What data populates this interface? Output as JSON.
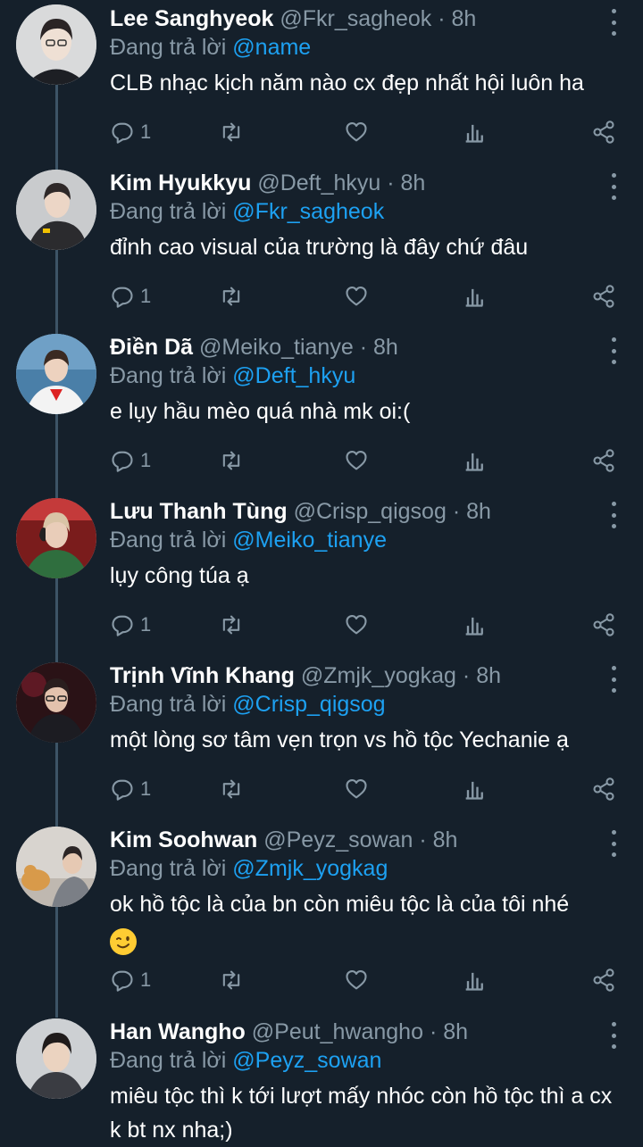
{
  "reply_prefix": "Đang trả lời",
  "tweets": [
    {
      "name": "Lee Sanghyeok",
      "handle": "@Fkr_sagheok",
      "time": "8h",
      "reply_to": "@name",
      "text": "CLB nhạc kịch năm nào cx đẹp nhất hội luôn ha",
      "replies": "1"
    },
    {
      "name": "Kim Hyukkyu",
      "handle": "@Deft_hkyu",
      "time": "8h",
      "reply_to": "@Fkr_sagheok",
      "text": "đỉnh cao visual của trường là đây chứ đâu",
      "replies": "1"
    },
    {
      "name": "Điền Dã",
      "handle": "@Meiko_tianye",
      "time": "8h",
      "reply_to": "@Deft_hkyu",
      "text": "e lụy hầu mèo quá nhà mk oi:(",
      "replies": "1"
    },
    {
      "name": "Lưu Thanh Tùng",
      "handle": "@Crisp_qigsog",
      "time": "8h",
      "reply_to": "@Meiko_tianye",
      "text": "lụy công túa ạ",
      "replies": "1"
    },
    {
      "name": "Trịnh Vĩnh Khang",
      "handle": "@Zmjk_yogkag",
      "time": "8h",
      "reply_to": "@Crisp_qigsog",
      "text": "một lòng sơ tâm vẹn trọn vs hồ tộc Yechanie ạ",
      "replies": "1"
    },
    {
      "name": "Kim Soohwan",
      "handle": "@Peyz_sowan",
      "time": "8h",
      "reply_to": "@Zmjk_yogkag",
      "text": "ok hồ tộc là của bn còn miêu tộc là của tôi nhé",
      "replies": "1",
      "emoji": "winking-face"
    },
    {
      "name": "Han Wangho",
      "handle": "@Peut_hwangho",
      "time": "8h",
      "reply_to": "@Peyz_sowan",
      "text": "miêu tộc thì k tới lượt mấy nhóc còn hồ tộc thì a cx k bt nx nha;)"
    }
  ],
  "theme": {
    "background": "#15202b",
    "secondary_text": "#8899a6",
    "link": "#1da1f2"
  },
  "icons": [
    "reply-icon",
    "retweet-icon",
    "like-icon",
    "analytics-icon",
    "share-icon",
    "more-icon"
  ]
}
